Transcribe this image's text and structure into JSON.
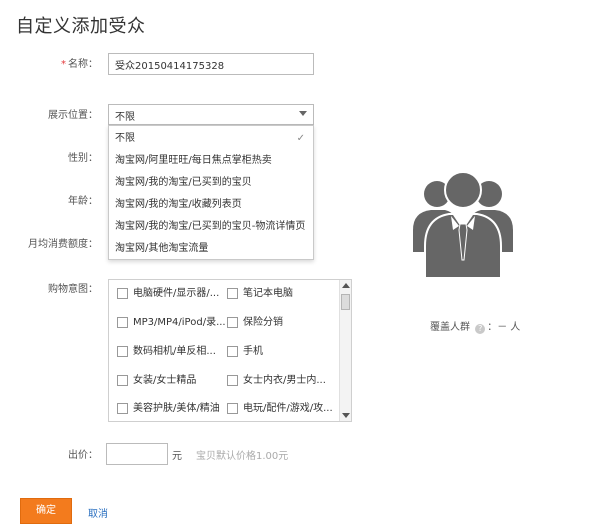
{
  "page": {
    "title": "自定义添加受众"
  },
  "form": {
    "name": {
      "required_mark": "*",
      "label": "名称：",
      "value": "受众20150414175328"
    },
    "position": {
      "label": "展示位置：",
      "selected": "不限",
      "options": [
        "不限",
        "淘宝网/阿里旺旺/每日焦点掌柜热卖",
        "淘宝网/我的淘宝/已买到的宝贝",
        "淘宝网/我的淘宝/收藏列表页",
        "淘宝网/我的淘宝/已买到的宝贝-物流详情页",
        "淘宝网/其他淘宝流量"
      ]
    },
    "gender": {
      "label": "性别："
    },
    "age": {
      "label": "年龄："
    },
    "spending": {
      "label": "月均消费额度："
    },
    "intent": {
      "label": "购物意图：",
      "items": [
        "电脑硬件/显示器/...",
        "笔记本电脑",
        "MP3/MP4/iPod/录...",
        "保险分销",
        "数码相机/单反相...",
        "手机",
        "女装/女士精品",
        "女士内衣/男士内...",
        "美容护肤/美体/精油",
        "电玩/配件/游戏/攻..."
      ]
    },
    "price": {
      "label": "出价：",
      "value": "",
      "unit": "元",
      "hint": "宝贝默认价格1.00元"
    }
  },
  "coverage": {
    "label": "覆盖人群",
    "help": "?",
    "sep": "：",
    "value": "－",
    "unit": "人"
  },
  "actions": {
    "confirm": "确定",
    "cancel": "取消"
  },
  "colors": {
    "accent": "#f37b1d",
    "link": "#2a6fc0",
    "required": "#e4393c",
    "avatar": "#666666"
  }
}
